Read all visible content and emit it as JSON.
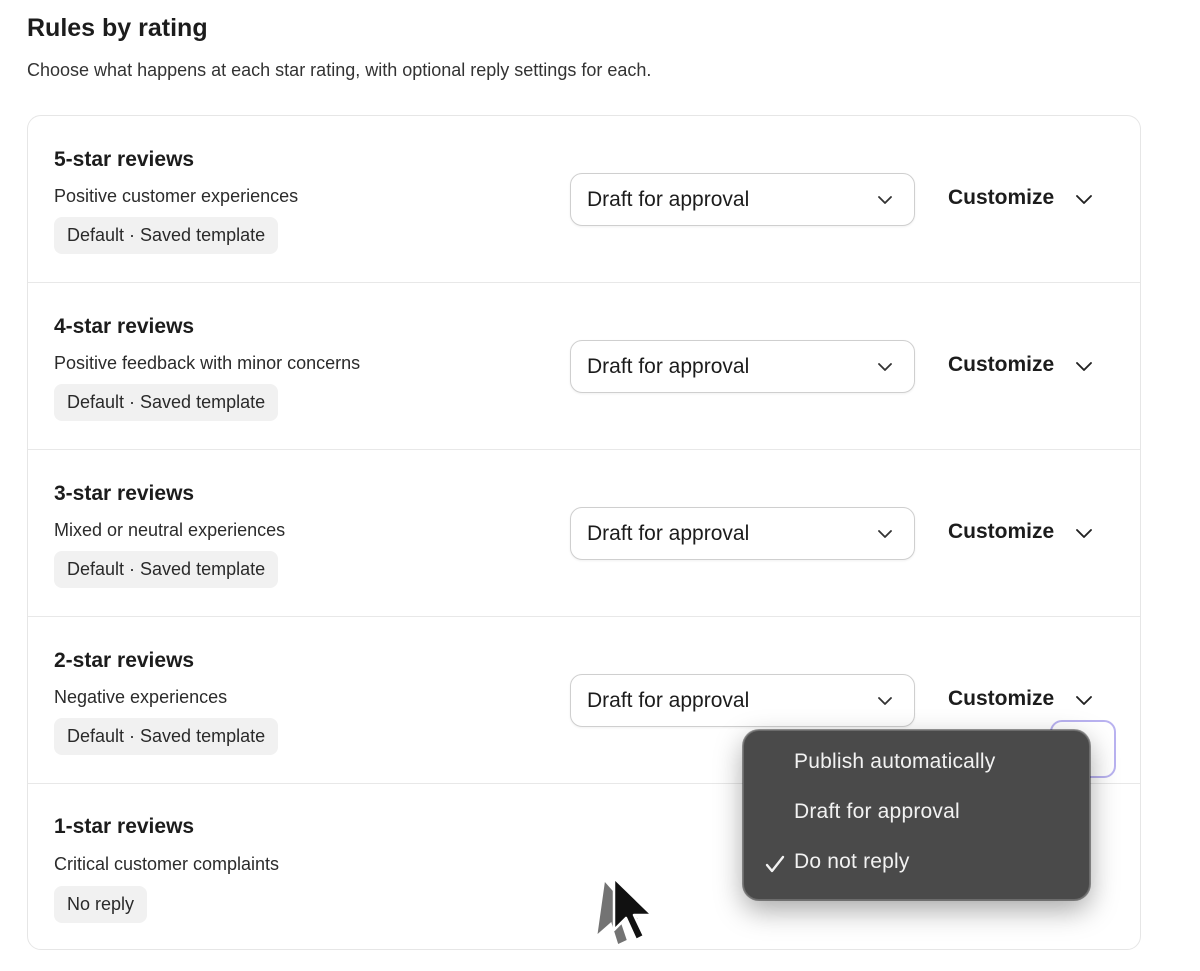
{
  "header": {
    "title": "Rules by rating",
    "subtitle": "Choose what happens at each star rating, with optional reply settings for each."
  },
  "rules": [
    {
      "title": "5-star reviews",
      "description": "Positive customer experiences",
      "badge": "Default · Saved template",
      "selected": "Draft for approval",
      "customize_label": "Customize"
    },
    {
      "title": "4-star reviews",
      "description": "Positive feedback with minor concerns",
      "badge": "Default · Saved template",
      "selected": "Draft for approval",
      "customize_label": "Customize"
    },
    {
      "title": "3-star reviews",
      "description": "Mixed or neutral experiences",
      "badge": "Default · Saved template",
      "selected": "Draft for approval",
      "customize_label": "Customize"
    },
    {
      "title": "2-star reviews",
      "description": "Negative experiences",
      "badge": "Default · Saved template",
      "selected": "Draft for approval",
      "customize_label": "Customize"
    },
    {
      "title": "1-star reviews",
      "description": "Critical customer complaints",
      "badge": "No reply"
    }
  ],
  "dropdown_menu": {
    "options": [
      "Publish automatically",
      "Draft for approval",
      "Do not reply"
    ],
    "checked_option": "Do not reply"
  },
  "colors": {
    "menu_background": "#4a4a4a",
    "focus_ring": "#b9b2f0",
    "badge_background": "#f1f1f1"
  },
  "icons": {
    "select_chevron": "chevron-down-icon",
    "check": "checkmark-icon",
    "cursor": "mouse-pointer-icon"
  }
}
